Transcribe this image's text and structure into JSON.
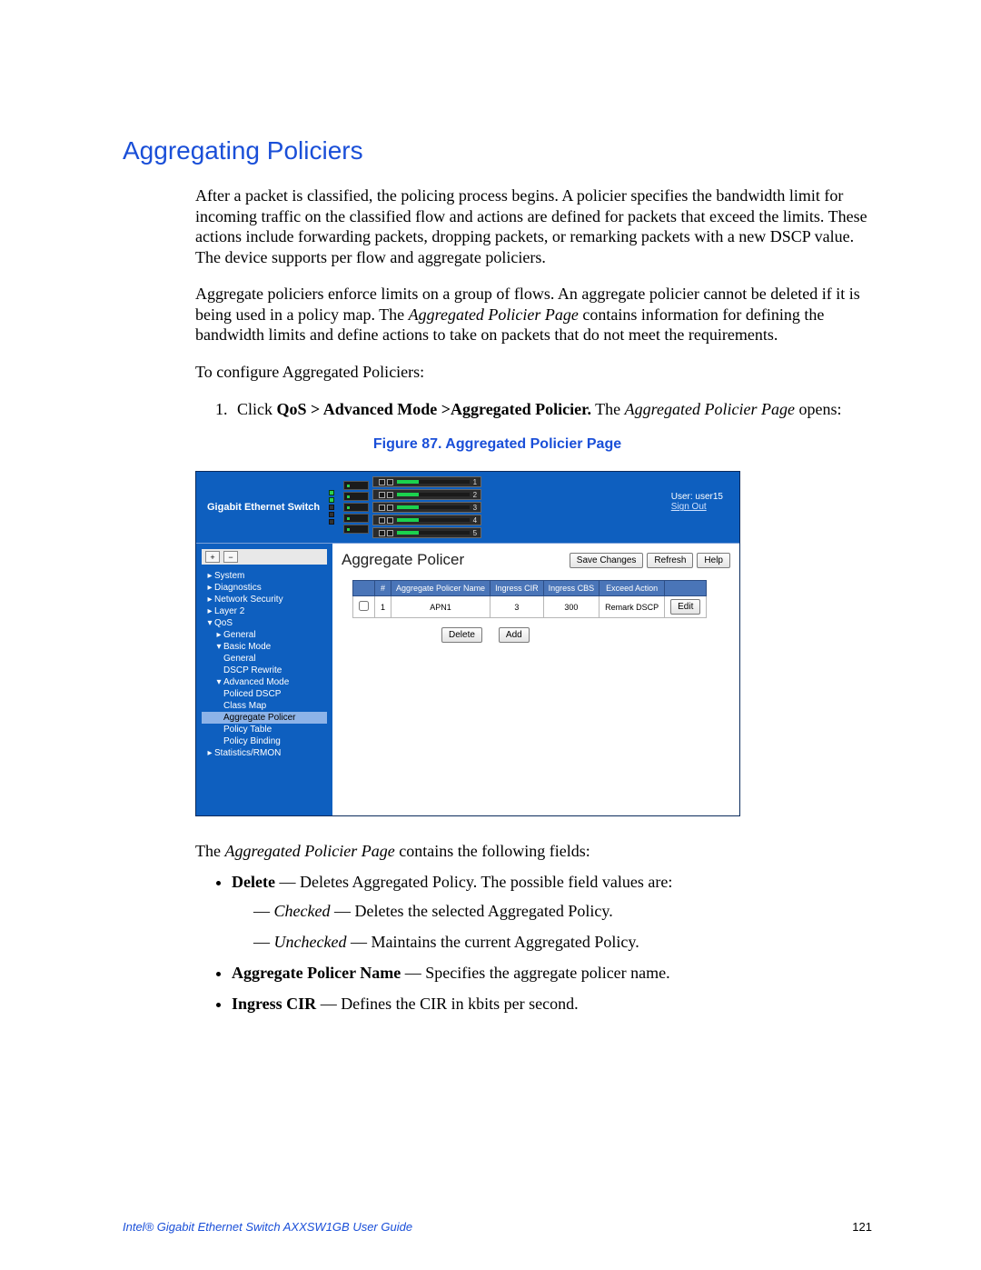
{
  "section_title": "Aggregating Policiers",
  "paragraphs": {
    "p1": "After a packet is classified, the policing process begins. A policier specifies the bandwidth limit for incoming traffic on the classified flow and actions are defined for packets that exceed the limits. These actions include forwarding packets, dropping packets, or remarking packets with a new DSCP value. The device supports per flow and aggregate policiers.",
    "p2_pre": "Aggregate policiers enforce limits on a group of flows. An aggregate policier cannot be deleted if it is being used in a policy map. The ",
    "p2_em": "Aggregated Policier Page",
    "p2_post": " contains information for defining the bandwidth limits and define actions to take on packets that do not meet the requirements.",
    "lead": "To configure Aggregated Policiers:"
  },
  "step1": {
    "pre": "Click ",
    "bold": "QoS > Advanced Mode >Aggregated Policier.",
    "mid": " The ",
    "em": "Aggregated Policier Page",
    "post": " opens:"
  },
  "figure_caption": "Figure 87. Aggregated Policier Page",
  "screenshot": {
    "product_title": "Gigabit Ethernet Switch",
    "user_label": "User: user15",
    "sign_out": "Sign Out",
    "content_title": "Aggregate Policer",
    "buttons": {
      "save": "Save Changes",
      "refresh": "Refresh",
      "help": "Help",
      "delete": "Delete",
      "add": "Add",
      "edit": "Edit"
    },
    "table": {
      "headers": {
        "chk": "",
        "idx": "#",
        "name": "Aggregate Policer Name",
        "cir": "Ingress CIR",
        "cbs": "Ingress CBS",
        "exceed": "Exceed Action",
        "act": ""
      },
      "row": {
        "idx": "1",
        "name": "APN1",
        "cir": "3",
        "cbs": "300",
        "exceed": "Remark DSCP"
      }
    },
    "tree": {
      "expand_all": "+",
      "collapse_all": "−",
      "system": "System",
      "diagnostics": "Diagnostics",
      "netsec": "Network Security",
      "layer2": "Layer 2",
      "qos": "QoS",
      "general": "General",
      "basic": "Basic Mode",
      "basic_general": "General",
      "dscp_rewrite": "DSCP Rewrite",
      "advanced": "Advanced Mode",
      "policed_dscp": "Policed DSCP",
      "class_map": "Class Map",
      "aggregate_policer": "Aggregate Policer",
      "policy_table": "Policy Table",
      "policy_binding": "Policy Binding",
      "stats": "Statistics/RMON"
    }
  },
  "after": {
    "lead_pre": "The ",
    "lead_em": "Aggregated Policier Page",
    "lead_post": " contains the following fields:",
    "fields": {
      "delete_label": "Delete",
      "delete_desc": " — Deletes Aggregated Policy. The possible field values are:",
      "checked_key": "Checked",
      "checked_desc": " — Deletes the selected Aggregated Policy.",
      "unchecked_key": "Unchecked",
      "unchecked_desc": " — Maintains the current Aggregated Policy.",
      "apn_label": "Aggregate Policer Name",
      "apn_desc": " — Specifies the aggregate policer name.",
      "cir_label": "Ingress CIR",
      "cir_desc": " — Defines the CIR in kbits per second."
    }
  },
  "footer": {
    "guide": "Intel® Gigabit Ethernet Switch AXXSW1GB User Guide",
    "page": "121"
  }
}
